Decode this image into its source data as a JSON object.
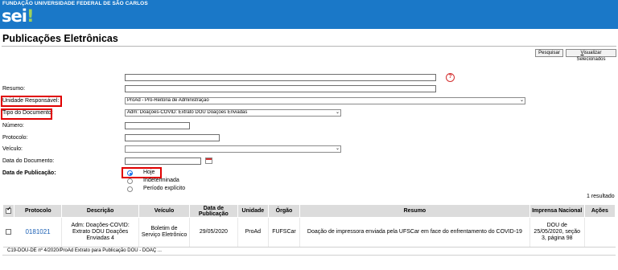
{
  "header": {
    "institution": "FUNDAÇÃO UNIVERSIDADE FEDERAL DE SÃO CARLOS",
    "logo_text": "sei",
    "logo_mark": "!"
  },
  "page": {
    "title": "Publicações Eletrônicas"
  },
  "toolbar": {
    "search_label": "Pesquisar",
    "view_selected_prefix": "V",
    "view_selected_rest": "isualizar Selecionados"
  },
  "form": {
    "top_field_value": "",
    "resumo_label": "Resumo:",
    "resumo_value": "",
    "unidade_label": "Unidade Responsável:",
    "unidade_value": "ProAd - Pró-Reitoria de Administração",
    "tipo_label": "Tipo do Documento:",
    "tipo_value": "Adm: Doações-COVID: Extrato DOU Doações Enviadas",
    "numero_label": "Número:",
    "numero_value": "",
    "protocolo_label": "Protocolo:",
    "protocolo_value": "",
    "veiculo_label": "Veículo:",
    "veiculo_value": "",
    "data_doc_label": "Data do Documento:",
    "data_doc_value": "",
    "data_pub_label": "Data de Publicação:",
    "radio_hoje": "Hoje",
    "radio_indeterminada": "Indeterminada",
    "radio_periodo": "Período explícito",
    "help_symbol": "?"
  },
  "results": {
    "count_text": "1 resultado",
    "columns": [
      "Protocolo",
      "Descrição",
      "Veículo",
      "Data de Publicação",
      "Unidade",
      "Órgão",
      "Resumo",
      "Imprensa Nacional",
      "Ações"
    ],
    "rows": [
      {
        "protocolo": "0181021",
        "descricao": "Adm: Doações-COVID: Extrato DOU Doações Enviadas 4",
        "veiculo": "Boletim de Serviço Eletrônico",
        "data": "29/05/2020",
        "unidade": "ProAd",
        "orgao": "FUFSCar",
        "resumo": "Doação de impressora enviada pela UFSCar em face do enfrentamento do COVID-19",
        "imprensa": "DOU de 25/05/2020, seção 3, página 98",
        "acoes": ""
      }
    ],
    "subrow_text": "C19-DOU-DE nº 4/2020/ProAd Extrato para Publicação DOU - DOAÇ ..."
  },
  "annotations": {
    "highlight_color": "#e00000"
  }
}
